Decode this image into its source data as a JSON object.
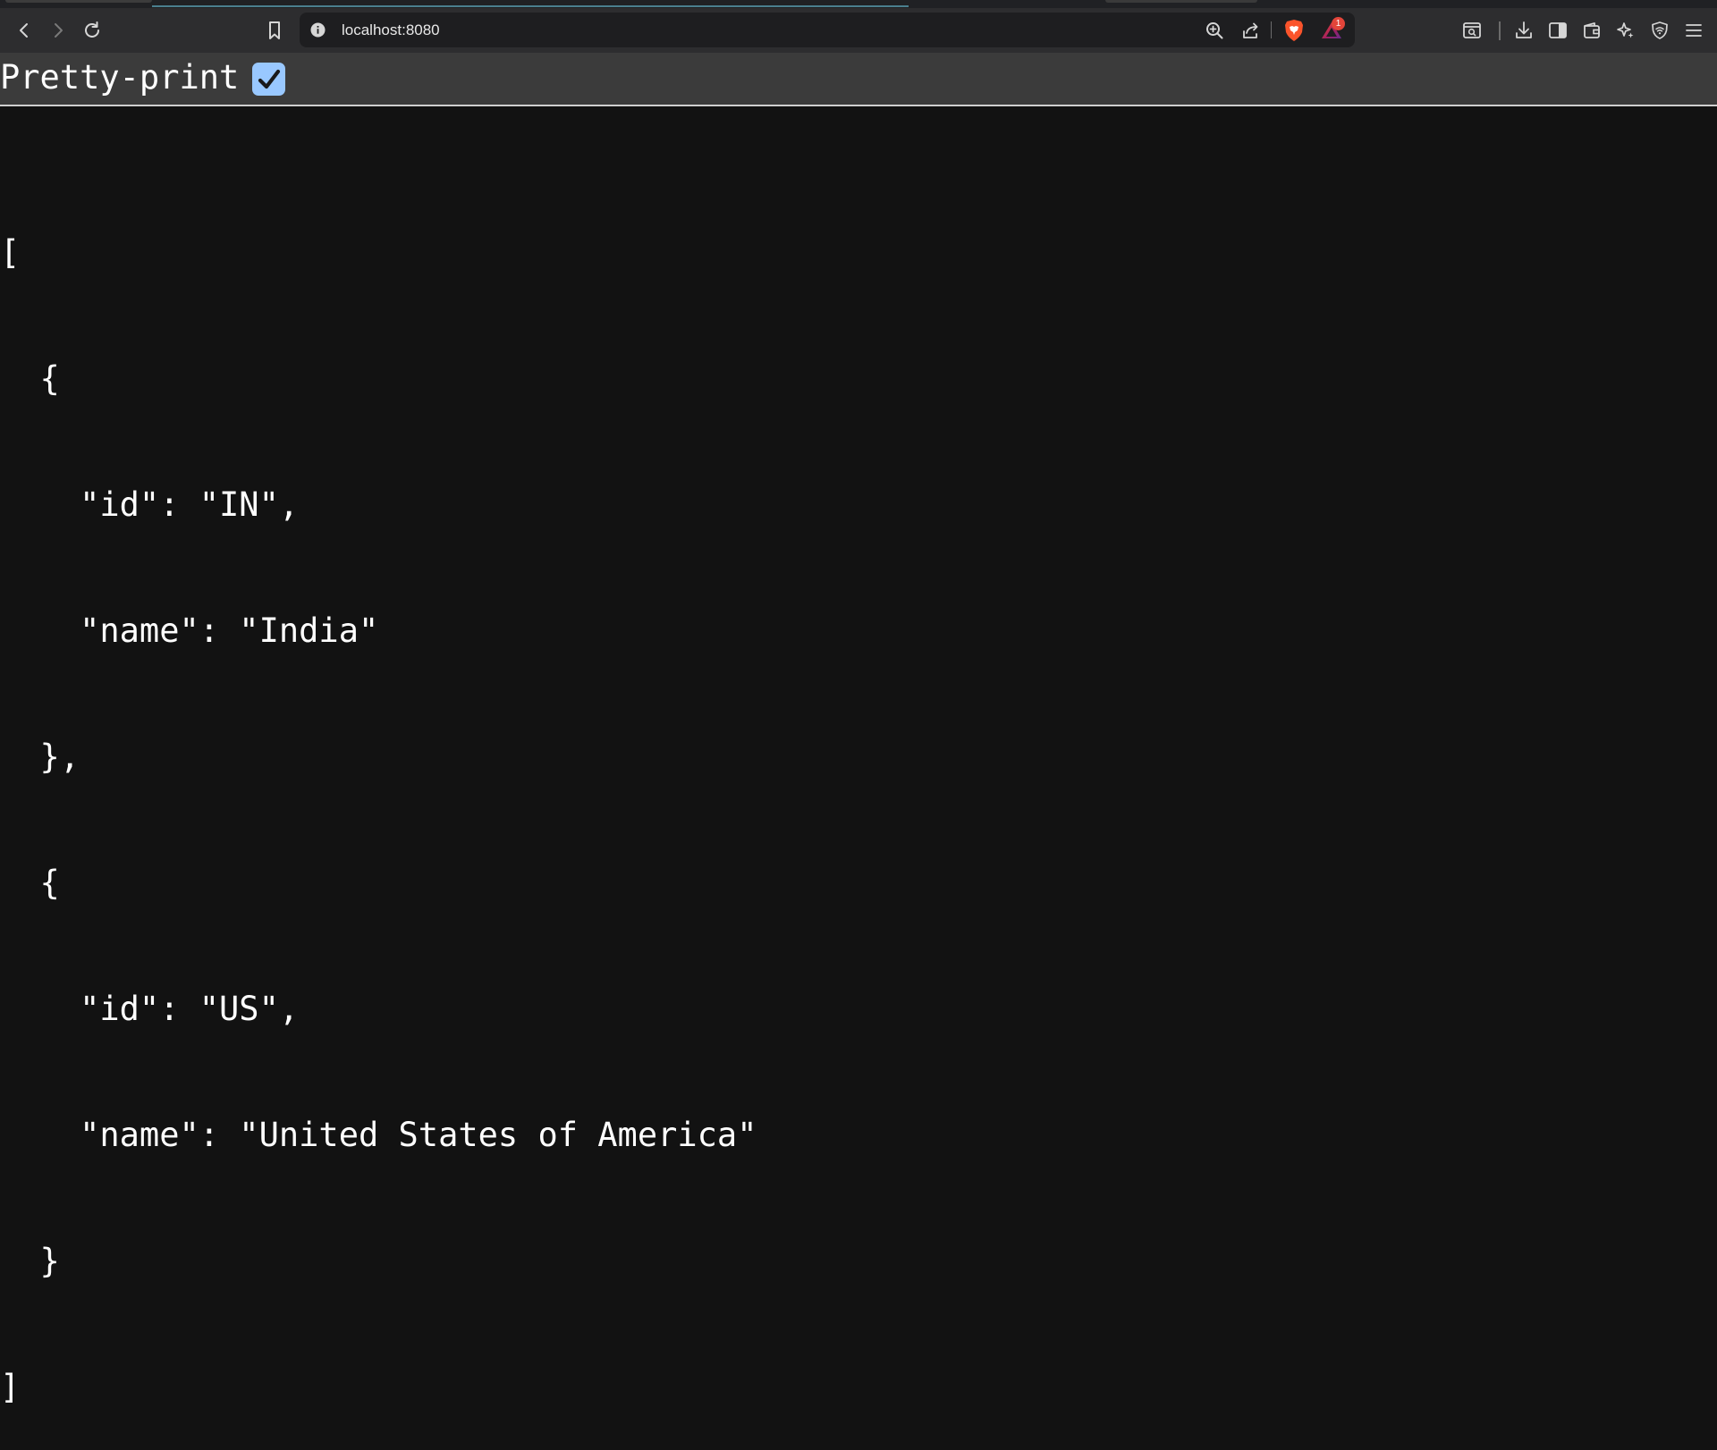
{
  "browser": {
    "url": "localhost:8080",
    "icons": {
      "back": "chevron-left-icon",
      "forward": "chevron-right-icon",
      "reload": "reload-icon",
      "bookmark": "bookmark-icon",
      "site_info": "info-icon",
      "zoom": "zoom-in-icon",
      "share": "share-icon",
      "shields": "brave-shields-icon",
      "rewards": "brave-rewards-icon",
      "tab_search": "tab-search-icon",
      "downloads": "download-icon",
      "sidebar": "sidebar-icon",
      "wallet": "wallet-icon",
      "leo": "sparkle-icon",
      "vpn": "vpn-shield-icon",
      "menu": "hamburger-menu-icon"
    },
    "rewards_badge": "1",
    "colors": {
      "toolbar": "#2d2d2f",
      "omnibox": "#1e1e20",
      "page_background": "#121212",
      "checkbox": "#99c8ff",
      "badge": "#e3453a"
    }
  },
  "page": {
    "pretty_print_label": "Pretty-print",
    "pretty_print_checked": true,
    "json_lines": [
      "[",
      "  {",
      "    \"id\": \"IN\",",
      "    \"name\": \"India\"",
      "  },",
      "  {",
      "    \"id\": \"US\",",
      "    \"name\": \"United States of America\"",
      "  }",
      "]"
    ]
  }
}
